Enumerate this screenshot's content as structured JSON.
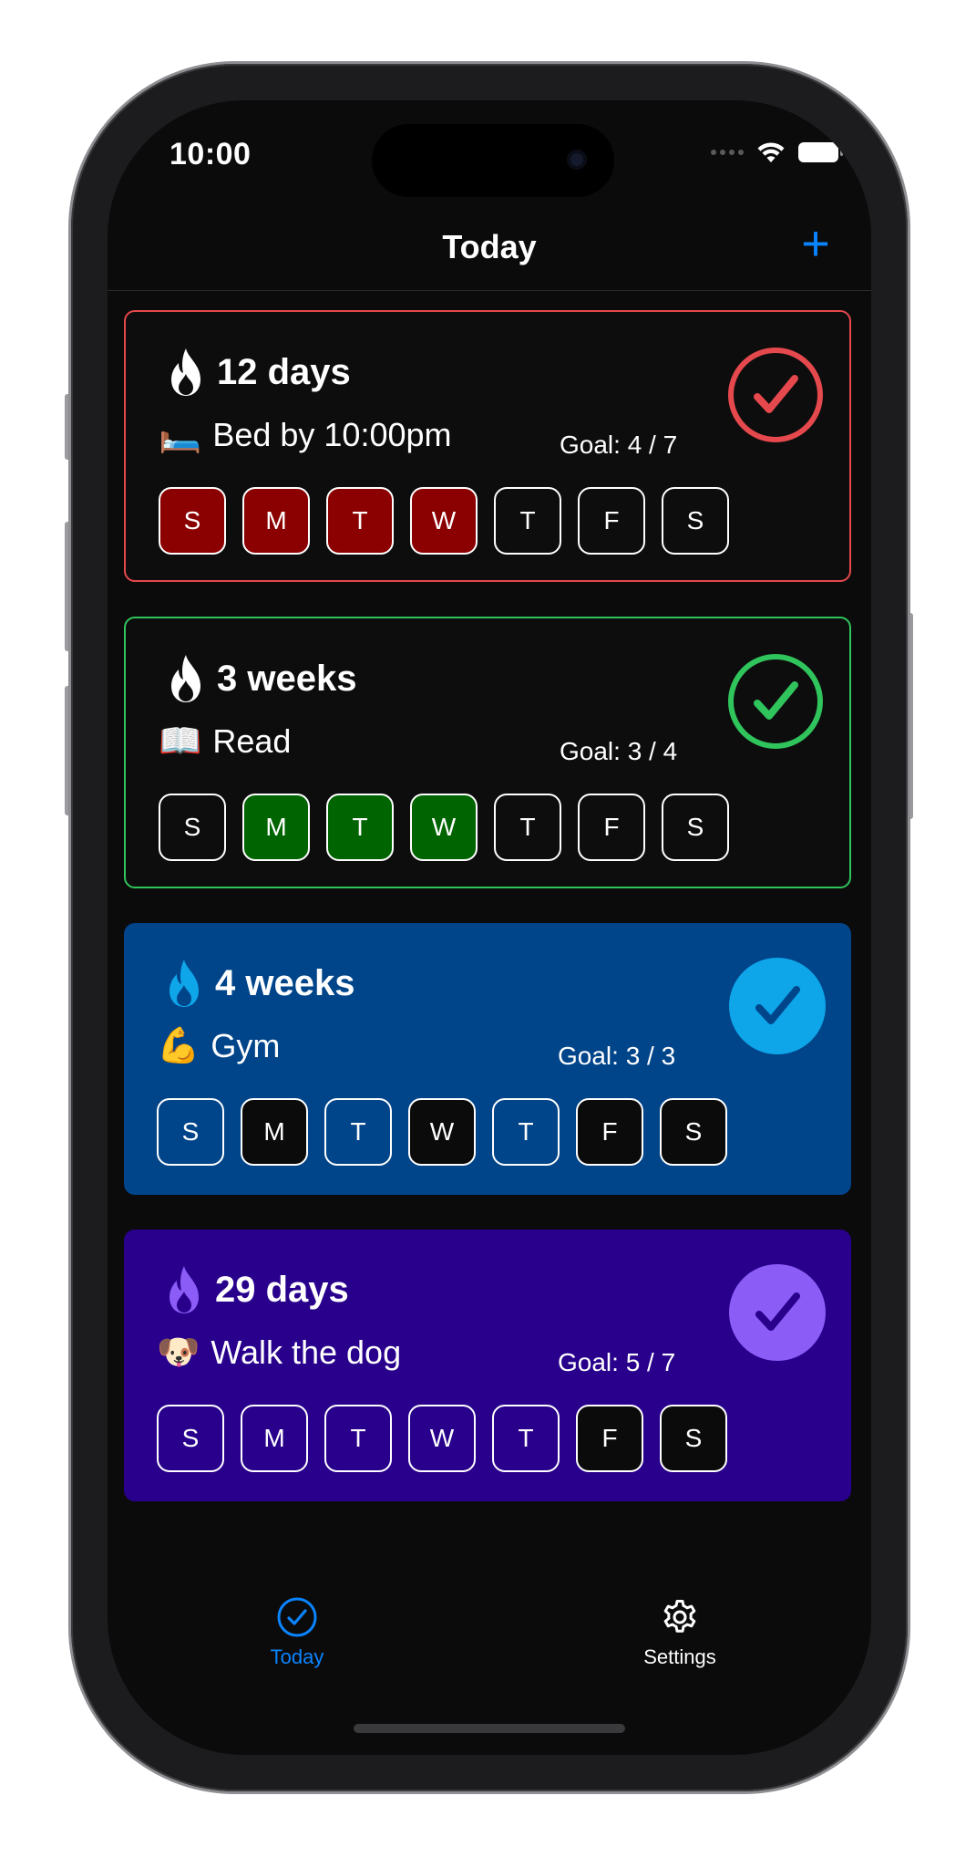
{
  "status_bar": {
    "time": "10:00"
  },
  "header": {
    "title": "Today",
    "add_label": "+"
  },
  "habits": [
    {
      "streak": "12 days",
      "emoji": "🛏️",
      "name": "Bed by 10:00pm",
      "goal": "Goal: 4 / 7",
      "theme": "red",
      "accent": "#e5484d",
      "completed": true,
      "days": [
        {
          "label": "S",
          "done": true
        },
        {
          "label": "M",
          "done": true
        },
        {
          "label": "T",
          "done": true
        },
        {
          "label": "W",
          "done": true
        },
        {
          "label": "T",
          "done": false
        },
        {
          "label": "F",
          "done": false
        },
        {
          "label": "S",
          "done": false
        }
      ],
      "fill_color": "#8b0000"
    },
    {
      "streak": "3 weeks",
      "emoji": "📖",
      "name": "Read",
      "goal": "Goal: 3 / 4",
      "theme": "green",
      "accent": "#30c45c",
      "completed": true,
      "days": [
        {
          "label": "S",
          "done": false
        },
        {
          "label": "M",
          "done": true
        },
        {
          "label": "T",
          "done": true
        },
        {
          "label": "W",
          "done": true
        },
        {
          "label": "T",
          "done": false
        },
        {
          "label": "F",
          "done": false
        },
        {
          "label": "S",
          "done": false
        }
      ],
      "fill_color": "#006400"
    },
    {
      "streak": "4 weeks",
      "emoji": "💪",
      "name": "Gym",
      "goal": "Goal: 3 / 3",
      "theme": "blue",
      "accent": "#0ea5e9",
      "completed": false,
      "days": [
        {
          "label": "S",
          "done": false
        },
        {
          "label": "M",
          "done": true
        },
        {
          "label": "T",
          "done": false
        },
        {
          "label": "W",
          "done": true
        },
        {
          "label": "T",
          "done": false
        },
        {
          "label": "F",
          "done": true
        },
        {
          "label": "S",
          "done": true
        }
      ],
      "fill_color": "#0b0b0b"
    },
    {
      "streak": "29 days",
      "emoji": "🐶",
      "name": "Walk the dog",
      "goal": "Goal: 5 / 7",
      "theme": "purple",
      "accent": "#8b5cf6",
      "completed": false,
      "days": [
        {
          "label": "S",
          "done": false
        },
        {
          "label": "M",
          "done": false
        },
        {
          "label": "T",
          "done": false
        },
        {
          "label": "W",
          "done": false
        },
        {
          "label": "T",
          "done": false
        },
        {
          "label": "F",
          "done": true
        },
        {
          "label": "S",
          "done": true
        }
      ],
      "fill_color": "#0b0b0b"
    }
  ],
  "tabbar": {
    "today_label": "Today",
    "settings_label": "Settings"
  },
  "colors": {
    "accent_blue": "#0a84ff",
    "background": "#0b0b0b"
  }
}
